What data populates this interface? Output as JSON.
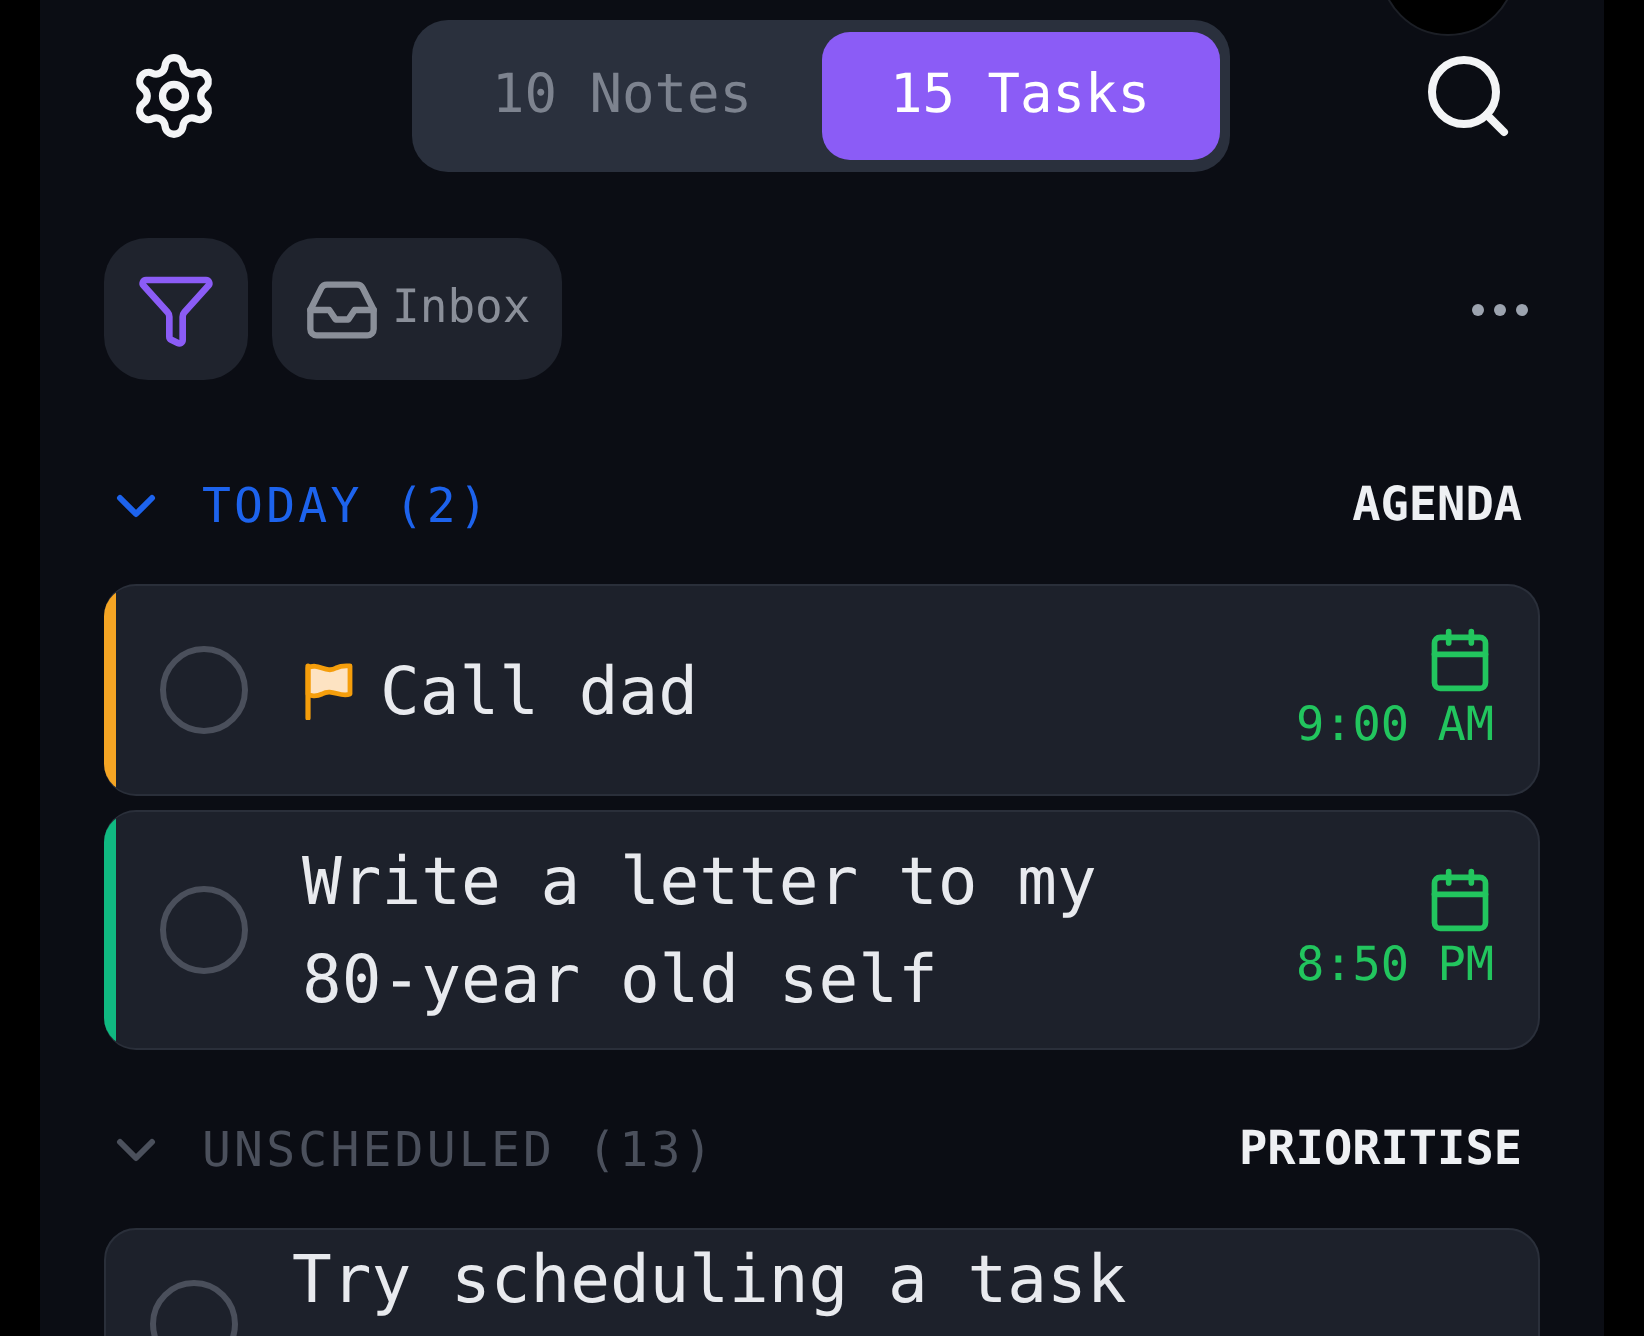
{
  "top_bar": {
    "tabs": [
      {
        "label": "10 Notes",
        "selected": false
      },
      {
        "label": "15 Tasks",
        "selected": true
      }
    ]
  },
  "toolbar": {
    "inbox_button": {
      "label": "Inbox"
    }
  },
  "sections": [
    {
      "title": "TODAY (2)",
      "highlighted": true,
      "expanded": true,
      "action": "AGENDA",
      "tasks": [
        {
          "title": "Call dad",
          "checked": false,
          "flagged": true,
          "color": "#f5a524",
          "time": "9:00 AM"
        },
        {
          "title": "Write a letter to my 80-year old self",
          "checked": false,
          "flagged": false,
          "color": "#10b981",
          "time": "8:50 PM"
        }
      ]
    },
    {
      "title": "UNSCHEDULED (13)",
      "highlighted": false,
      "expanded": true,
      "action": "PRIORITISE",
      "tasks": [
        {
          "title": "Try scheduling a task",
          "checked": false,
          "flagged": false
        }
      ]
    }
  ]
}
